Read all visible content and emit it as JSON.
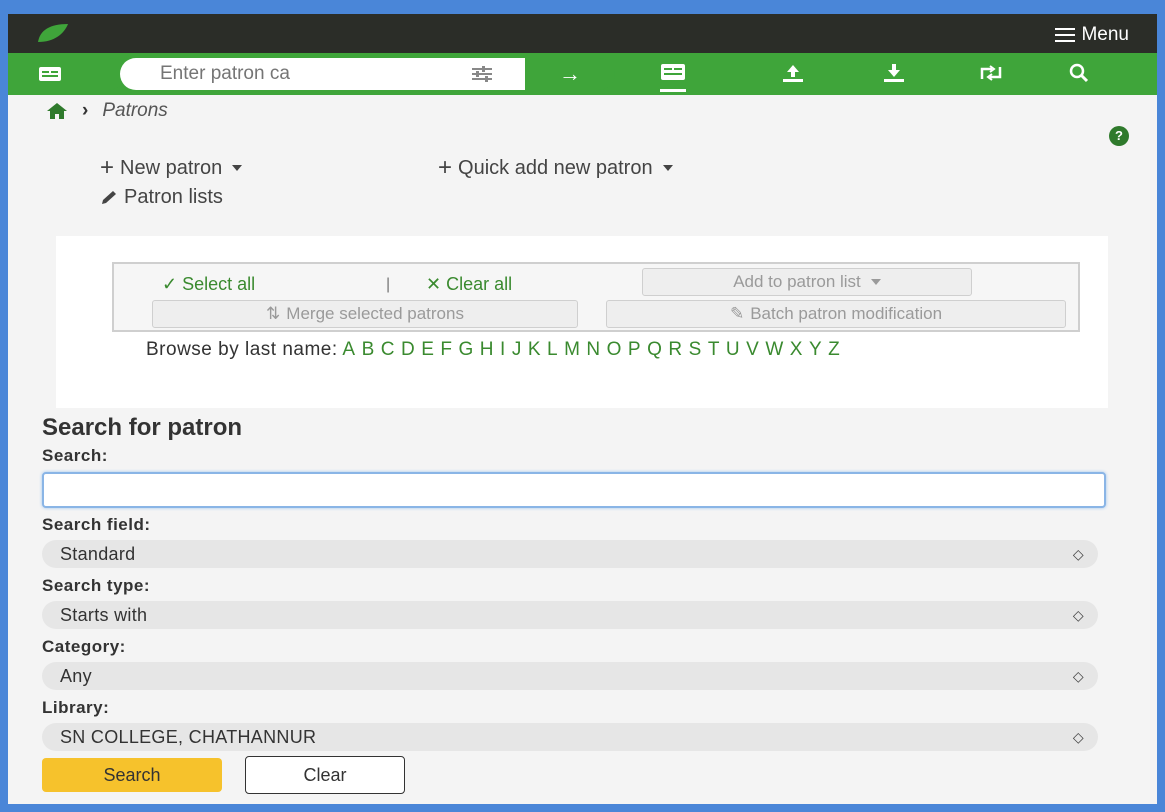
{
  "header": {
    "menu_label": "Menu"
  },
  "searchbar": {
    "placeholder": "Enter patron ca"
  },
  "breadcrumb": {
    "current": "Patrons"
  },
  "help": {
    "label": "?"
  },
  "actions": {
    "new_patron": "New patron",
    "quick_add": "Quick add new patron",
    "patron_lists": "Patron lists"
  },
  "toolbar": {
    "select_all": "Select all",
    "separator": "|",
    "clear_all": "Clear all",
    "add_to_list": "Add to patron list",
    "merge": "Merge selected patrons",
    "batch_mod": "Batch patron modification"
  },
  "browse": {
    "label": "Browse by last name:",
    "letters": [
      "A",
      "B",
      "C",
      "D",
      "E",
      "F",
      "G",
      "H",
      "I",
      "J",
      "K",
      "L",
      "M",
      "N",
      "O",
      "P",
      "Q",
      "R",
      "S",
      "T",
      "U",
      "V",
      "W",
      "X",
      "Y",
      "Z"
    ]
  },
  "search_form": {
    "title": "Search for patron",
    "search_label": "Search:",
    "search_value": "",
    "field_label": "Search field:",
    "field_value": "Standard",
    "type_label": "Search type:",
    "type_value": "Starts with",
    "category_label": "Category:",
    "category_value": "Any",
    "library_label": "Library:",
    "library_value": "SN COLLEGE, CHATHANNUR",
    "search_button": "Search",
    "clear_button": "Clear"
  },
  "colors": {
    "topbar": "#2b2d28",
    "green": "#3fa53a",
    "link_green": "#3a8a2f",
    "search_btn": "#f6c22c",
    "frame": "#4a86d8"
  },
  "icons": [
    "koha-logo-icon",
    "hamburger-icon",
    "patron-card-icon",
    "filter-sliders-icon",
    "arrow-right-icon",
    "checkout-card-icon",
    "checkin-upload-icon",
    "download-icon",
    "renew-icon",
    "search-icon",
    "home-icon",
    "chevron-right-icon",
    "help-icon",
    "plus-icon",
    "pencil-icon",
    "checkmark-icon",
    "x-icon",
    "merge-icon"
  ]
}
